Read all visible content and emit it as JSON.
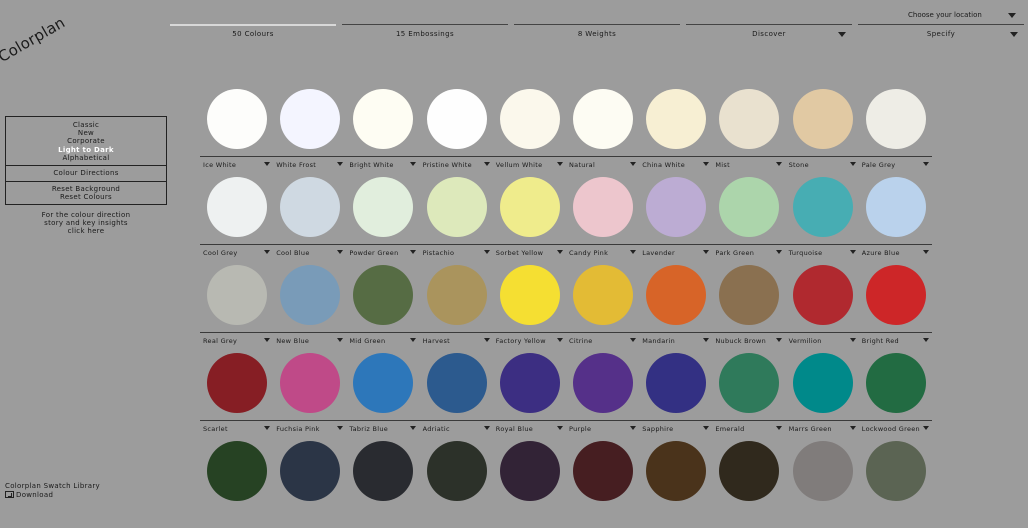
{
  "brand": {
    "logo_text": "Colorplan"
  },
  "header": {
    "location_label": "Choose your location"
  },
  "tabs": [
    {
      "label": "50 Colours",
      "active": true,
      "dropdown": false
    },
    {
      "label": "15 Embossings",
      "active": false,
      "dropdown": false
    },
    {
      "label": "8 Weights",
      "active": false,
      "dropdown": false
    },
    {
      "label": "Discover",
      "active": false,
      "dropdown": true
    },
    {
      "label": "Specify",
      "active": false,
      "dropdown": true
    }
  ],
  "sidebar": {
    "sort_options": [
      "Classic",
      "New",
      "Corporate",
      "Light to Dark",
      "Alphabetical"
    ],
    "selected_sort": "Light to Dark",
    "colour_directions": "Colour Directions",
    "reset_background": "Reset Background",
    "reset_colours": "Reset Colours",
    "story_text": [
      "For the colour direction",
      "story and key insights",
      "click here"
    ]
  },
  "swatches": [
    [
      {
        "name": "Ice White",
        "color": "#fdfdfb"
      },
      {
        "name": "White Frost",
        "color": "#f4f5ff"
      },
      {
        "name": "Bright White",
        "color": "#fefdf3"
      },
      {
        "name": "Pristine White",
        "color": "#fefefe"
      },
      {
        "name": "Vellum White",
        "color": "#fbf8ec"
      },
      {
        "name": "Natural",
        "color": "#fdfcf3"
      },
      {
        "name": "China White",
        "color": "#f7efd3"
      },
      {
        "name": "Mist",
        "color": "#e9e1cf"
      },
      {
        "name": "Stone",
        "color": "#e1c9a3"
      },
      {
        "name": "Pale Grey",
        "color": "#eeede6"
      }
    ],
    [
      {
        "name": "Cool Grey",
        "color": "#eef1f1"
      },
      {
        "name": "Cool Blue",
        "color": "#cfd9e2"
      },
      {
        "name": "Powder Green",
        "color": "#e1eedd"
      },
      {
        "name": "Pistachio",
        "color": "#dde9bb"
      },
      {
        "name": "Sorbet Yellow",
        "color": "#efec8c"
      },
      {
        "name": "Candy Pink",
        "color": "#edc6cd"
      },
      {
        "name": "Lavender",
        "color": "#bcacd3"
      },
      {
        "name": "Park Green",
        "color": "#acd5ab"
      },
      {
        "name": "Turquoise",
        "color": "#47adb3"
      },
      {
        "name": "Azure Blue",
        "color": "#bad2ec"
      }
    ],
    [
      {
        "name": "Real Grey",
        "color": "#b8b9b2"
      },
      {
        "name": "New Blue",
        "color": "#799bb8"
      },
      {
        "name": "Mid Green",
        "color": "#566c44"
      },
      {
        "name": "Harvest",
        "color": "#aa945d"
      },
      {
        "name": "Factory Yellow",
        "color": "#f5df32"
      },
      {
        "name": "Citrine",
        "color": "#e3bb35"
      },
      {
        "name": "Mandarin",
        "color": "#d76428"
      },
      {
        "name": "Nubuck Brown",
        "color": "#8a7050"
      },
      {
        "name": "Vermilion",
        "color": "#b0292f"
      },
      {
        "name": "Bright Red",
        "color": "#cd2628"
      }
    ],
    [
      {
        "name": "Scarlet",
        "color": "#861e24"
      },
      {
        "name": "Fuchsia Pink",
        "color": "#bf4a88"
      },
      {
        "name": "Tabriz Blue",
        "color": "#2d77ba"
      },
      {
        "name": "Adriatic",
        "color": "#2c5a8e"
      },
      {
        "name": "Royal Blue",
        "color": "#3c2e82"
      },
      {
        "name": "Purple",
        "color": "#553089"
      },
      {
        "name": "Sapphire",
        "color": "#333083"
      },
      {
        "name": "Emerald",
        "color": "#2f7a5b"
      },
      {
        "name": "Marrs Green",
        "color": "#00898a"
      },
      {
        "name": "Lockwood Green",
        "color": "#226b42"
      }
    ],
    [
      {
        "name": "",
        "color": "#264223"
      },
      {
        "name": "",
        "color": "#2b3546"
      },
      {
        "name": "",
        "color": "#292b30"
      },
      {
        "name": "",
        "color": "#2c3129"
      },
      {
        "name": "",
        "color": "#322336"
      },
      {
        "name": "",
        "color": "#461e21"
      },
      {
        "name": "",
        "color": "#4a331b"
      },
      {
        "name": "",
        "color": "#30291d"
      },
      {
        "name": "",
        "color": "#807c7b"
      },
      {
        "name": "",
        "color": "#5b6453"
      }
    ]
  ],
  "footer": {
    "library_label": "Colorplan Swatch Library",
    "download_label": "Download"
  }
}
